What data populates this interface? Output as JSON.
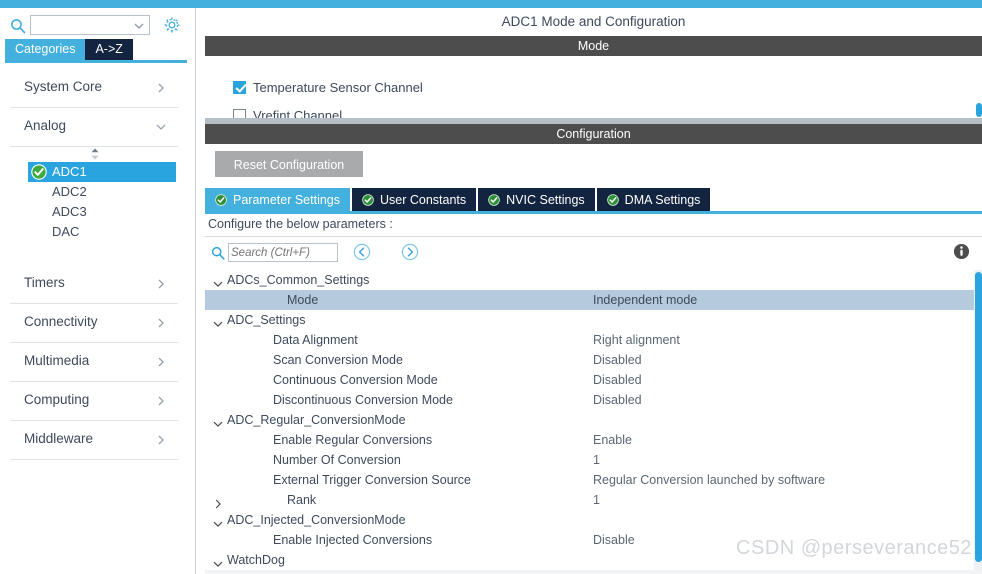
{
  "colors": {
    "accent_blue": "#44b0dd",
    "deep_navy": "#12243f",
    "section_gray": "#4d4d4d",
    "row_highlight": "#b6cade",
    "selection_blue": "#29a4df",
    "green_check": "#3ea93e"
  },
  "sidebar": {
    "search": {
      "icon": "search-icon",
      "value": "",
      "placeholder": "",
      "dropdown_icon": "chevron-down-icon"
    },
    "settings_icon": "gear-icon",
    "tabs": [
      {
        "label": "Categories",
        "selected": true
      },
      {
        "label": "A->Z",
        "selected": false
      }
    ],
    "groups": [
      {
        "label": "System Core",
        "expanded": false,
        "chevron": "chevron-right-icon"
      },
      {
        "label": "Analog",
        "expanded": true,
        "chevron": "chevron-down-icon"
      },
      {
        "label": "Timers",
        "expanded": false,
        "chevron": "chevron-right-icon"
      },
      {
        "label": "Connectivity",
        "expanded": false,
        "chevron": "chevron-right-icon"
      },
      {
        "label": "Multimedia",
        "expanded": false,
        "chevron": "chevron-right-icon"
      },
      {
        "label": "Computing",
        "expanded": false,
        "chevron": "chevron-right-icon"
      },
      {
        "label": "Middleware",
        "expanded": false,
        "chevron": "chevron-right-icon"
      }
    ],
    "analog_items": [
      {
        "label": "ADC1",
        "selected": true,
        "configured": true
      },
      {
        "label": "ADC2",
        "selected": false,
        "configured": false
      },
      {
        "label": "ADC3",
        "selected": false,
        "configured": false
      },
      {
        "label": "DAC",
        "selected": false,
        "configured": false
      }
    ]
  },
  "panel": {
    "title": "ADC1 Mode and Configuration",
    "mode_bar": "Mode",
    "config_bar": "Configuration",
    "mode_options": [
      {
        "label": "Temperature Sensor Channel",
        "checked": true
      },
      {
        "label": "Vrefint Channel",
        "checked": false
      }
    ],
    "reset_button": "Reset Configuration",
    "settings_tabs": [
      {
        "label": "Parameter Settings",
        "active": true,
        "icon": "check-circle-icon"
      },
      {
        "label": "User Constants",
        "active": false,
        "icon": "check-circle-icon"
      },
      {
        "label": "NVIC Settings",
        "active": false,
        "icon": "check-circle-icon"
      },
      {
        "label": "DMA Settings",
        "active": false,
        "icon": "check-circle-icon"
      }
    ],
    "configure_label": "Configure the below parameters :",
    "param_search": {
      "icon": "search-icon",
      "value": "",
      "placeholder": "Search (Ctrl+F)"
    },
    "prev_icon": "prev-match-icon",
    "next_icon": "next-match-icon",
    "info_icon": "info-icon",
    "parameters": [
      {
        "kind": "group",
        "twisty": "chevron-down-icon",
        "name": "ADCs_Common_Settings",
        "value": "",
        "highlight": false
      },
      {
        "kind": "param",
        "twisty": "",
        "name": "Mode",
        "value": "Independent mode",
        "highlight": true,
        "indent": 2
      },
      {
        "kind": "group",
        "twisty": "chevron-down-icon",
        "name": "ADC_Settings",
        "value": "",
        "highlight": false
      },
      {
        "kind": "param",
        "twisty": "",
        "name": "Data Alignment",
        "value": "Right alignment",
        "highlight": false,
        "indent": 1
      },
      {
        "kind": "param",
        "twisty": "",
        "name": "Scan Conversion Mode",
        "value": "Disabled",
        "highlight": false,
        "indent": 1
      },
      {
        "kind": "param",
        "twisty": "",
        "name": "Continuous Conversion Mode",
        "value": "Disabled",
        "highlight": false,
        "indent": 1
      },
      {
        "kind": "param",
        "twisty": "",
        "name": "Discontinuous Conversion Mode",
        "value": "Disabled",
        "highlight": false,
        "indent": 1
      },
      {
        "kind": "group",
        "twisty": "chevron-down-icon",
        "name": "ADC_Regular_ConversionMode",
        "value": "",
        "highlight": false
      },
      {
        "kind": "param",
        "twisty": "",
        "name": "Enable Regular Conversions",
        "value": "Enable",
        "highlight": false,
        "indent": 1
      },
      {
        "kind": "param",
        "twisty": "",
        "name": "Number Of Conversion",
        "value": "1",
        "highlight": false,
        "indent": 1
      },
      {
        "kind": "param",
        "twisty": "",
        "name": "External Trigger Conversion Source",
        "value": "Regular Conversion launched by software",
        "highlight": false,
        "indent": 1
      },
      {
        "kind": "param",
        "twisty": "chevron-right-icon",
        "name": "Rank",
        "value": "1",
        "highlight": false,
        "indent": 2
      },
      {
        "kind": "group",
        "twisty": "chevron-down-icon",
        "name": "ADC_Injected_ConversionMode",
        "value": "",
        "highlight": false
      },
      {
        "kind": "param",
        "twisty": "",
        "name": "Enable Injected Conversions",
        "value": "Disable",
        "highlight": false,
        "indent": 1
      },
      {
        "kind": "group",
        "twisty": "chevron-down-icon",
        "name": "WatchDog",
        "value": "",
        "highlight": false
      }
    ]
  },
  "watermark": "CSDN @perseverance52"
}
